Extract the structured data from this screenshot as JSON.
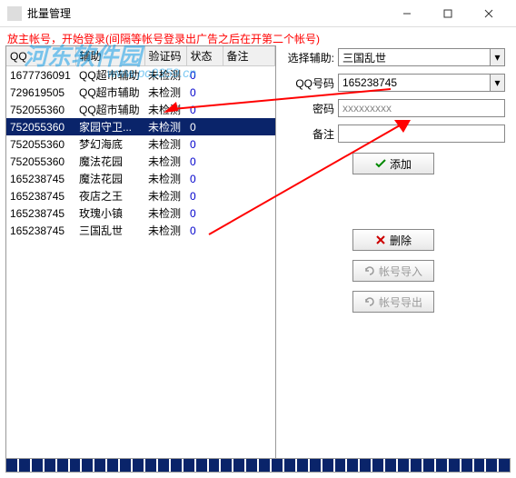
{
  "window": {
    "title": "批量管理"
  },
  "hint": "放主帐号，开始登录(间隔等帐号登录出广告之后在开第二个帐号)",
  "watermark": {
    "line1": "河东软件园",
    "line2": "www.pc0359.cn"
  },
  "table": {
    "headers": [
      "QQ",
      "辅助",
      "验证码",
      "状态",
      "备注"
    ],
    "rows": [
      {
        "qq": "1677736091",
        "assist": "QQ超市辅助",
        "verify": "未检测",
        "count": "0",
        "note": ""
      },
      {
        "qq": "729619505",
        "assist": "QQ超市辅助",
        "verify": "未检测",
        "count": "0",
        "note": ""
      },
      {
        "qq": "752055360",
        "assist": "QQ超市辅助",
        "verify": "未检测",
        "count": "0",
        "note": ""
      },
      {
        "qq": "752055360",
        "assist": "家园守卫...",
        "verify": "未检测",
        "count": "0",
        "note": "",
        "selected": true
      },
      {
        "qq": "752055360",
        "assist": "梦幻海底",
        "verify": "未检测",
        "count": "0",
        "note": ""
      },
      {
        "qq": "752055360",
        "assist": "魔法花园",
        "verify": "未检测",
        "count": "0",
        "note": ""
      },
      {
        "qq": "165238745",
        "assist": "魔法花园",
        "verify": "未检测",
        "count": "0",
        "note": ""
      },
      {
        "qq": "165238745",
        "assist": "夜店之王",
        "verify": "未检测",
        "count": "0",
        "note": ""
      },
      {
        "qq": "165238745",
        "assist": "玫瑰小镇",
        "verify": "未检测",
        "count": "0",
        "note": ""
      },
      {
        "qq": "165238745",
        "assist": "三国乱世",
        "verify": "未检测",
        "count": "0",
        "note": ""
      }
    ]
  },
  "form": {
    "assist_label": "选择辅助:",
    "assist_value": "三国乱世",
    "qq_label": "QQ号码",
    "qq_value": "165238745",
    "pwd_label": "密码",
    "pwd_value": "xxxxxxxxx",
    "note_label": "备注",
    "note_value": ""
  },
  "buttons": {
    "add": "添加",
    "delete": "删除",
    "import": "帐号导入",
    "export": "帐号导出"
  }
}
